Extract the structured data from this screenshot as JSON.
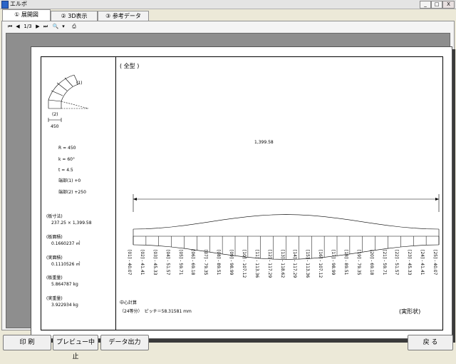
{
  "window": {
    "title": "エルボ",
    "minimize": "_",
    "maximize": "□",
    "close": "X"
  },
  "tabs": [
    {
      "label": "① 展開図"
    },
    {
      "label": "② 3D表示"
    },
    {
      "label": "③ 参考データ"
    }
  ],
  "viewer_toolbar": {
    "page": "1/3"
  },
  "drawing": {
    "type_label": "( 全型 )",
    "diagram_labels": {
      "mark1": "(1)",
      "mark2": "(2)",
      "dim": "450"
    },
    "params": [
      {
        "label": "R = 450"
      },
      {
        "label": "k = 60°"
      },
      {
        "label": "t = 4.5"
      },
      {
        "label": "端部(1)  +0"
      },
      {
        "label": "端部(2)  +250"
      }
    ],
    "specs": [
      {
        "title": "(板寸法)",
        "value": "237.25 × 1,399.58"
      },
      {
        "title": "(板面積)",
        "value": "0.1660237 ㎡"
      },
      {
        "title": "(実面積)",
        "value": "0.1110526 ㎡"
      },
      {
        "title": "(板重量)",
        "value": "5.864787 kg"
      },
      {
        "title": "(実重量)",
        "value": "3.922934 kg"
      }
    ],
    "total_width_label": "1,399.58",
    "division_labels": [
      "[01] - 40.07",
      "[02] - 41.41",
      "[03] - 45.33",
      "[04] - 51.57",
      "[05] - 59.71",
      "[06] - 69.18",
      "[07] - 79.35",
      "[08] - 89.51",
      "[09] - 98.99",
      "[10] - 107.12",
      "[11] - 113.36",
      "[12] - 117.29",
      "[13] - 118.62",
      "[14] - 117.29",
      "[15] - 113.36",
      "[16] - 107.12",
      "[17] - 98.99",
      "[18] - 89.51",
      "[19] - 79.35",
      "[20] - 69.18",
      "[21] - 59.71",
      "[22] - 51.57",
      "[23] - 45.33",
      "[24] - 41.41",
      "[25] - 40.07"
    ],
    "calc_title": "中心計算",
    "calc_detail": "（24等分）　ピッチ＝58.31581 mm",
    "shape_label": "(実形状)"
  },
  "buttons": {
    "print": "印 刷",
    "stop_preview": "プレビュー中止",
    "export": "データ出力",
    "back": "戻 る"
  },
  "colors": {
    "viewer_bg": "#8e8e8e",
    "chrome_bg": "#ece9d8",
    "active_tab": "#ffffff"
  }
}
